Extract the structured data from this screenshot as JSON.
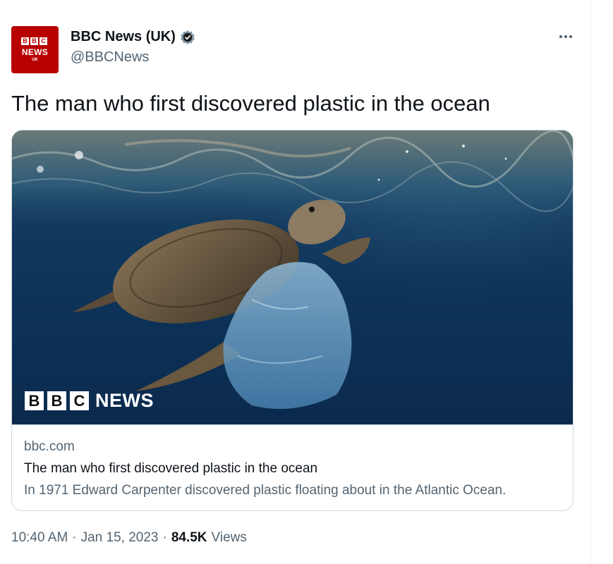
{
  "tweet": {
    "author": {
      "display_name": "BBC News (UK)",
      "handle": "@BBCNews",
      "verified": true,
      "avatar": {
        "blocks": [
          "B",
          "B",
          "C"
        ],
        "word": "NEWS",
        "region": "UK"
      }
    },
    "more_icon": "more-horizontal-icon",
    "text": "The man who first discovered plastic in the ocean",
    "card": {
      "image_logo": {
        "blocks": [
          "B",
          "B",
          "C"
        ],
        "word": "NEWS"
      },
      "domain": "bbc.com",
      "title": "The man who first discovered plastic in the ocean",
      "description": "In 1971 Edward Carpenter discovered plastic floating about in the Atlantic Ocean."
    },
    "meta": {
      "time": "10:40 AM",
      "separator": "·",
      "date": "Jan 15, 2023",
      "views_count": "84.5K",
      "views_label": "Views"
    }
  },
  "colors": {
    "bbc_red": "#b80000",
    "text_primary": "#0f1419",
    "text_secondary": "#536471",
    "border": "#cfd9de",
    "ocean": "#0d3157"
  }
}
